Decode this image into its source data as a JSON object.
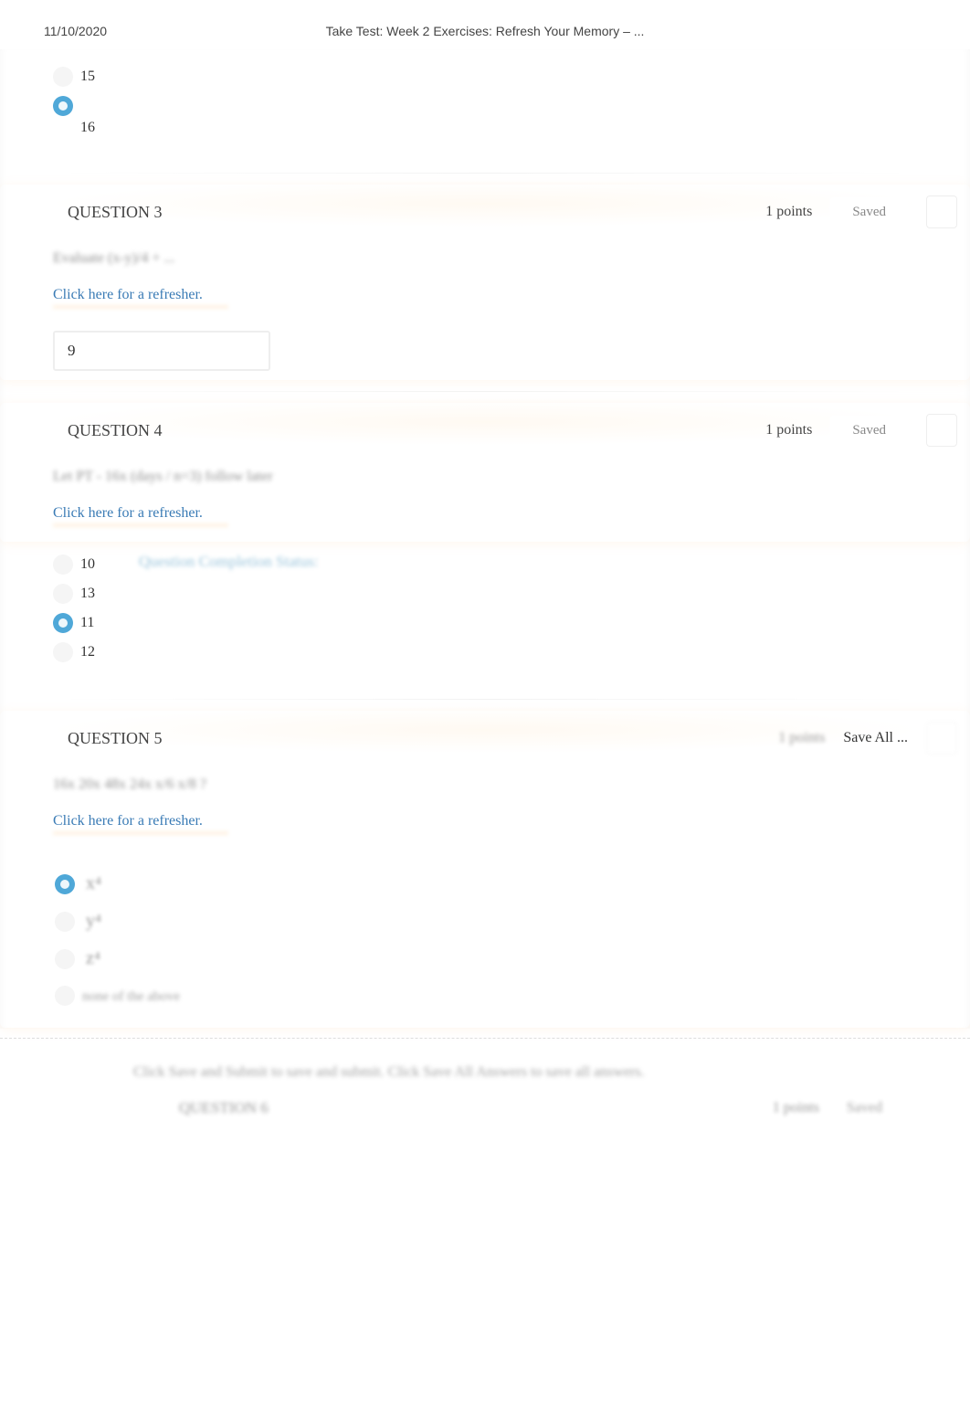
{
  "header": {
    "date": "11/10/2020",
    "title": "Take Test: Week 2 Exercises: Refresh Your Memory – ..."
  },
  "q2_top": {
    "options": [
      {
        "label": "15",
        "selected": false
      },
      {
        "label": "16",
        "selected": true,
        "label_below": true
      }
    ]
  },
  "q3": {
    "title": "QUESTION 3",
    "points": "1 points",
    "saved": "Saved",
    "expression": "Evaluate (x-y)/4 + ...",
    "refresher": "Click here for a refresher.",
    "input_value": "9"
  },
  "q4": {
    "title": "QUESTION 4",
    "points": "1 points",
    "saved": "Saved",
    "expression": "Let PT ‑ 16x (days / n=3) follow later",
    "refresher": "Click here for a refresher.",
    "completion_text": "Question Completion Status:",
    "options": [
      {
        "label": "10",
        "selected": false
      },
      {
        "label": "13",
        "selected": false
      },
      {
        "label": "11",
        "selected": true
      },
      {
        "label": "12",
        "selected": false
      }
    ]
  },
  "q5": {
    "title": "QUESTION 5",
    "points": "1 points",
    "save_all": "Save All ...",
    "expression": "16x 20x 48x 24x x/6 x/8 ?",
    "refresher": "Click here for a refresher.",
    "options": [
      {
        "img": "x⁴",
        "selected": true
      },
      {
        "img": "y⁴",
        "selected": false
      },
      {
        "img": "z⁴",
        "selected": false
      }
    ],
    "none_label": "none of the above"
  },
  "bottom": {
    "instruction": "Click Save and Submit to save and submit. Click Save All Answers to save all answers.",
    "q6_title": "QUESTION 6",
    "q6_points": "1 points",
    "q6_saved": "Saved"
  }
}
